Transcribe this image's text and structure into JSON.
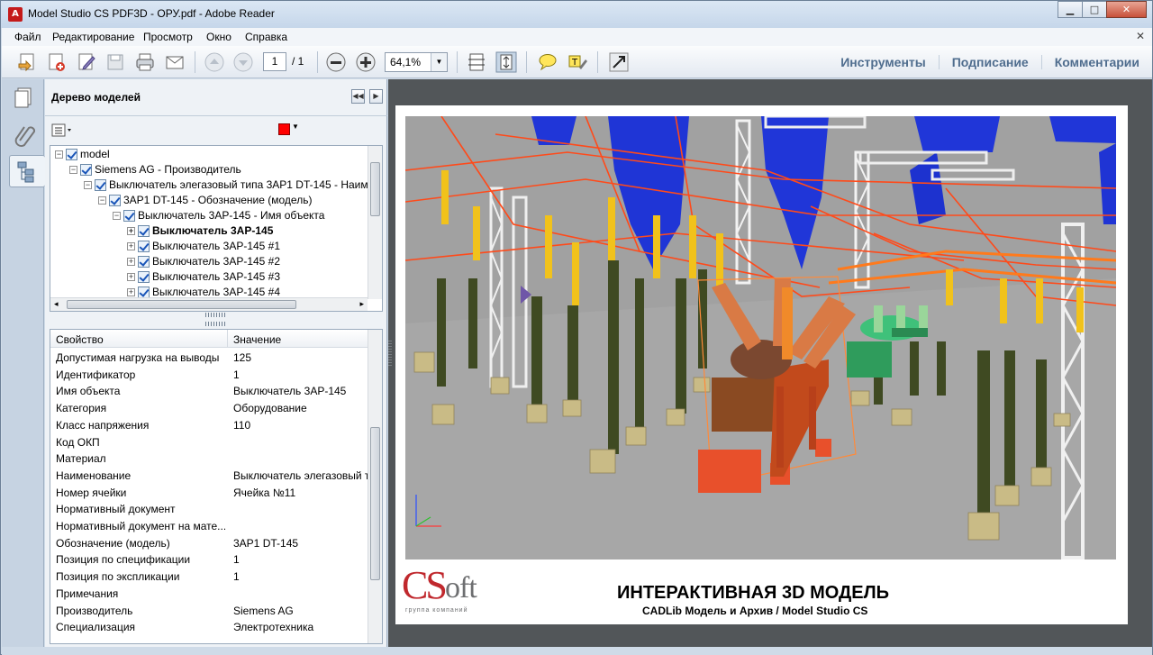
{
  "window": {
    "title": "Model Studio CS PDF3D - ОРУ.pdf - Adobe Reader",
    "minimize": "▁",
    "maximize": "□",
    "close": "✕"
  },
  "menu": {
    "items": [
      "Файл",
      "Редактирование",
      "Просмотр",
      "Окно",
      "Справка"
    ],
    "close": "✕"
  },
  "toolbar": {
    "page_current": "1",
    "page_total": "/ 1",
    "zoom": "64,1%",
    "links": [
      "Инструменты",
      "Подписание",
      "Комментарии"
    ]
  },
  "model_tree": {
    "title": "Дерево моделей",
    "color_swatch": "#ff0000",
    "nodes": [
      {
        "label": "model",
        "expander": "−"
      },
      {
        "label": "Siemens AG - Производитель",
        "expander": "−"
      },
      {
        "label": "Выключатель элегазовый типа 3AP1 DT-145 - Наим",
        "expander": "−"
      },
      {
        "label": "3AP1 DT-145 - Обозначение (модель)",
        "expander": "−"
      },
      {
        "label": "Выключатель 3AP-145 - Имя объекта",
        "expander": "−"
      },
      {
        "label": "Выключатель 3AP-145",
        "expander": "+"
      },
      {
        "label": "Выключатель 3AP-145 #1",
        "expander": "+"
      },
      {
        "label": "Выключатель 3AP-145 #2",
        "expander": "+"
      },
      {
        "label": "Выключатель 3AP-145 #3",
        "expander": "+"
      },
      {
        "label": "Выключатель 3AP-145 #4",
        "expander": "+"
      }
    ],
    "scroll_arrows": [
      "◂",
      "▸"
    ]
  },
  "properties": {
    "col_property": "Свойство",
    "col_value": "Значение",
    "rows": [
      {
        "key": "Допустимая нагрузка на выводы",
        "value": "125"
      },
      {
        "key": "Идентификатор",
        "value": "1"
      },
      {
        "key": "Имя объекта",
        "value": "Выключатель 3AP-145"
      },
      {
        "key": "Категория",
        "value": "Оборудование"
      },
      {
        "key": "Класс напряжения",
        "value": "110"
      },
      {
        "key": "Код ОКП",
        "value": ""
      },
      {
        "key": "Материал",
        "value": ""
      },
      {
        "key": "Наименование",
        "value": "Выключатель элегазовый т"
      },
      {
        "key": "Номер ячейки",
        "value": "Ячейка №11"
      },
      {
        "key": "Нормативный документ",
        "value": ""
      },
      {
        "key": "Нормативный документ на мате...",
        "value": ""
      },
      {
        "key": "Обозначение (модель)",
        "value": "3AP1 DT-145"
      },
      {
        "key": "Позиция по спецификации",
        "value": "1"
      },
      {
        "key": "Позиция по экспликации",
        "value": "1"
      },
      {
        "key": "Примечания",
        "value": ""
      },
      {
        "key": "Производитель",
        "value": "Siemens AG"
      },
      {
        "key": "Специализация",
        "value": "Электротехника"
      }
    ]
  },
  "document": {
    "title": "ИНТЕРАКТИВНАЯ 3D МОДЕЛЬ",
    "subtitle": "CADLib Модель и Архив / Model Studio CS",
    "logo_cs": "CS",
    "logo_soft": "oft",
    "logo_tagline": "группа компаний"
  }
}
